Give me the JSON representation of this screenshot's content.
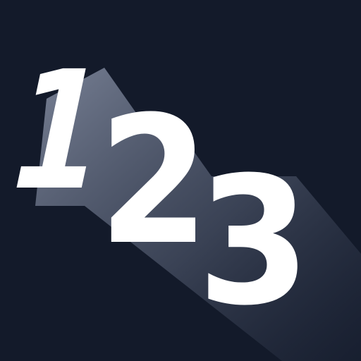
{
  "app_icon": {
    "digit_one": "1",
    "digit_two": "2",
    "digit_three": "3"
  },
  "colors": {
    "background": "#131a2a",
    "digits": "#ffffff",
    "long_shadow": "#8a93a8"
  }
}
